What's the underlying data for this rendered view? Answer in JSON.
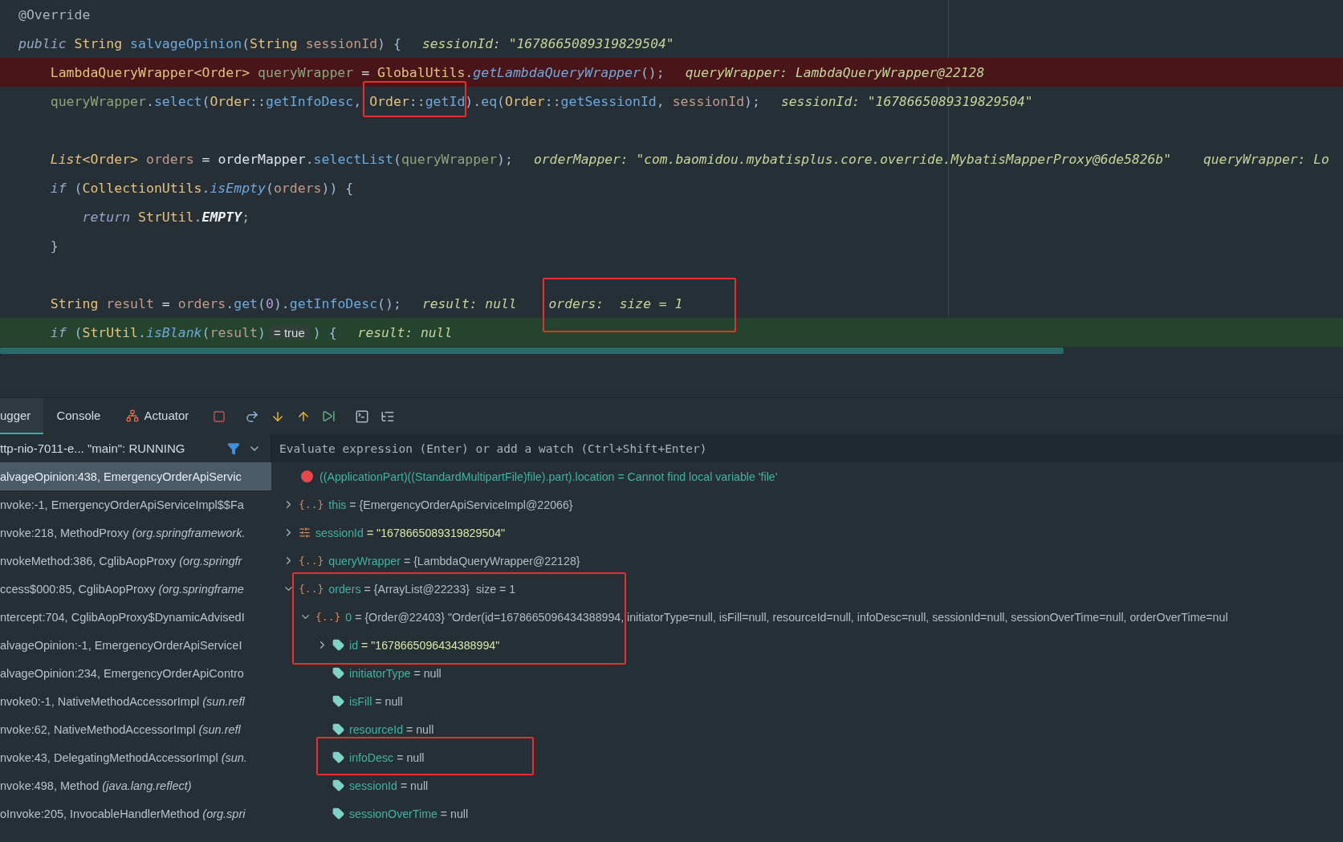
{
  "editor": {
    "lines": [
      {
        "kind": "code",
        "breakpoint": false,
        "execution_point": false,
        "tokens": [
          {
            "text": "@Override",
            "kind": "annotation"
          }
        ]
      },
      {
        "kind": "code",
        "breakpoint": false,
        "execution_point": false,
        "tokens": [
          {
            "text": "public",
            "kind": "kw"
          },
          {
            "text": " String ",
            "kind": "type"
          },
          {
            "text": "salvageOpinion",
            "kind": "method"
          },
          {
            "text": "(",
            "kind": "punct"
          },
          {
            "text": "String ",
            "kind": "type"
          },
          {
            "text": "sessionId",
            "kind": "local"
          },
          {
            "text": ") {",
            "kind": "punct"
          }
        ],
        "hints": [
          "sessionId: \"1678665089319829504\""
        ]
      },
      {
        "kind": "code",
        "breakpoint": true,
        "execution_point": false,
        "tokens": [
          {
            "text": "    LambdaQueryWrapper<Order> ",
            "kind": "type"
          },
          {
            "text": "queryWrapper",
            "kind": "field"
          },
          {
            "text": " = ",
            "kind": "plain"
          },
          {
            "text": "GlobalUtils",
            "kind": "type"
          },
          {
            "text": ".",
            "kind": "punct"
          },
          {
            "text": "getLambdaQueryWrapper",
            "kind": "static"
          },
          {
            "text": "();",
            "kind": "punct"
          }
        ],
        "hints": [
          "queryWrapper: LambdaQueryWrapper@22128"
        ]
      },
      {
        "kind": "code",
        "breakpoint": false,
        "execution_point": false,
        "tokens": [
          {
            "text": "    queryWrapper",
            "kind": "field"
          },
          {
            "text": ".",
            "kind": "punct"
          },
          {
            "text": "select",
            "kind": "method"
          },
          {
            "text": "(",
            "kind": "punct"
          },
          {
            "text": "Order",
            "kind": "type"
          },
          {
            "text": "::",
            "kind": "punct"
          },
          {
            "text": "getInfoDesc",
            "kind": "method"
          },
          {
            "text": ", ",
            "kind": "punct"
          },
          {
            "text": "Order",
            "kind": "type"
          },
          {
            "text": "::",
            "kind": "punct"
          },
          {
            "text": "getId",
            "kind": "method"
          },
          {
            "text": ").",
            "kind": "punct"
          },
          {
            "text": "eq",
            "kind": "method"
          },
          {
            "text": "(",
            "kind": "punct"
          },
          {
            "text": "Order",
            "kind": "type"
          },
          {
            "text": "::",
            "kind": "punct"
          },
          {
            "text": "getSessionId",
            "kind": "method"
          },
          {
            "text": ", ",
            "kind": "punct"
          },
          {
            "text": "sessionId",
            "kind": "local"
          },
          {
            "text": ");",
            "kind": "punct"
          }
        ],
        "hints": [
          "sessionId: \"1678665089319829504\""
        ]
      },
      {
        "kind": "blank"
      },
      {
        "kind": "code",
        "breakpoint": false,
        "execution_point": false,
        "tokens": [
          {
            "text": "    List",
            "kind": "kwtype"
          },
          {
            "text": "<Order> ",
            "kind": "type"
          },
          {
            "text": "orders",
            "kind": "local"
          },
          {
            "text": " = ",
            "kind": "plain"
          },
          {
            "text": "orderMapper",
            "kind": "plain"
          },
          {
            "text": ".",
            "kind": "punct"
          },
          {
            "text": "selectList",
            "kind": "method"
          },
          {
            "text": "(",
            "kind": "punct"
          },
          {
            "text": "queryWrapper",
            "kind": "field"
          },
          {
            "text": ");",
            "kind": "punct"
          }
        ],
        "hints": [
          "orderMapper: \"com.baomidou.mybatisplus.core.override.MybatisMapperProxy@6de5826b\"",
          "queryWrapper: Lo"
        ]
      },
      {
        "kind": "code",
        "breakpoint": false,
        "execution_point": false,
        "tokens": [
          {
            "text": "    if",
            "kind": "kw"
          },
          {
            "text": " (",
            "kind": "punct"
          },
          {
            "text": "CollectionUtils",
            "kind": "type"
          },
          {
            "text": ".",
            "kind": "punct"
          },
          {
            "text": "isEmpty",
            "kind": "static"
          },
          {
            "text": "(",
            "kind": "punct"
          },
          {
            "text": "orders",
            "kind": "local"
          },
          {
            "text": ")) {",
            "kind": "punct"
          }
        ]
      },
      {
        "kind": "code",
        "breakpoint": false,
        "execution_point": false,
        "tokens": [
          {
            "text": "        return",
            "kind": "kw"
          },
          {
            "text": " StrUtil",
            "kind": "type"
          },
          {
            "text": ".",
            "kind": "punct"
          },
          {
            "text": "EMPTY",
            "kind": "const"
          },
          {
            "text": ";",
            "kind": "punct"
          }
        ]
      },
      {
        "kind": "code",
        "breakpoint": false,
        "execution_point": false,
        "tokens": [
          {
            "text": "    }",
            "kind": "punct"
          }
        ]
      },
      {
        "kind": "blank"
      },
      {
        "kind": "code",
        "breakpoint": false,
        "execution_point": false,
        "tokens": [
          {
            "text": "    String ",
            "kind": "type"
          },
          {
            "text": "result",
            "kind": "local"
          },
          {
            "text": " = ",
            "kind": "plain"
          },
          {
            "text": "orders",
            "kind": "local"
          },
          {
            "text": ".",
            "kind": "punct"
          },
          {
            "text": "get",
            "kind": "method"
          },
          {
            "text": "(",
            "kind": "punct"
          },
          {
            "text": "0",
            "kind": "number"
          },
          {
            "text": ").",
            "kind": "punct"
          },
          {
            "text": "getInfoDesc",
            "kind": "method"
          },
          {
            "text": "();",
            "kind": "punct"
          }
        ],
        "hints": [
          "result: null",
          "orders:  size = 1"
        ]
      },
      {
        "kind": "code",
        "breakpoint": false,
        "execution_point": true,
        "tokens": [
          {
            "text": "    if",
            "kind": "kw"
          },
          {
            "text": " (",
            "kind": "punct"
          },
          {
            "text": "StrUtil",
            "kind": "type"
          },
          {
            "text": ".",
            "kind": "punct"
          },
          {
            "text": "isBlank",
            "kind": "static"
          },
          {
            "text": "(",
            "kind": "punct"
          },
          {
            "text": "result",
            "kind": "local"
          },
          {
            "text": ")",
            "kind": "punct"
          },
          {
            "text": "= true",
            "kind": "chip"
          },
          {
            "text": ") {",
            "kind": "punct"
          }
        ],
        "hints": [
          "result: null"
        ]
      }
    ]
  },
  "debugger": {
    "tabs": [
      {
        "label": "ugger",
        "selected": true,
        "icon": false
      },
      {
        "label": "Console",
        "selected": false,
        "icon": false
      },
      {
        "label": "Actuator",
        "selected": false,
        "icon": true
      }
    ],
    "thread": "ttp-nio-7011-e... \"main\": RUNNING",
    "evaluate": {
      "placeholder": "Evaluate expression (Enter) or add a watch (Ctrl+Shift+Enter)"
    },
    "frames": [
      {
        "method": "alvageOpinion:438, EmergencyOrderApiServic",
        "selected": true
      },
      {
        "method": "nvoke:-1, EmergencyOrderApiServiceImpl$$Fa",
        "selected": false
      },
      {
        "method": "nvoke:218, MethodProxy",
        "location": "(org.springframework.",
        "selected": false
      },
      {
        "method": "nvokeMethod:386, CglibAopProxy",
        "location": "(org.springfr",
        "selected": false
      },
      {
        "method": "ccess$000:85, CglibAopProxy",
        "location": "(org.springframe",
        "selected": false
      },
      {
        "method": "ntercept:704, CglibAopProxy$DynamicAdvisedI",
        "selected": false
      },
      {
        "method": "alvageOpinion:-1, EmergencyOrderApiServiceI",
        "selected": false
      },
      {
        "method": "alvageOpinion:234, EmergencyOrderApiContro",
        "selected": false
      },
      {
        "method": "nvoke0:-1, NativeMethodAccessorImpl",
        "location": "(sun.refl",
        "selected": false
      },
      {
        "method": "nvoke:62, NativeMethodAccessorImpl",
        "location": "(sun.refl",
        "selected": false
      },
      {
        "method": "nvoke:43, DelegatingMethodAccessorImpl",
        "location": "(sun.",
        "selected": false
      },
      {
        "method": "nvoke:498, Method",
        "location": "(java.lang.reflect)",
        "selected": false
      },
      {
        "method": "oInvoke:205, InvocableHandlerMethod",
        "location": "(org.spri",
        "selected": false
      }
    ],
    "variables": [
      {
        "kind": "error",
        "text": "((ApplicationPart)((StandardMultipartFile)file).part).location = Cannot find local variable 'file'"
      },
      {
        "kind": "object",
        "expanded": false,
        "icon": "{..}",
        "name": "this",
        "value": "= {EmergencyOrderApiServiceImpl@22066}",
        "string_value": false
      },
      {
        "kind": "primitive",
        "expanded": false,
        "name": "sessionId",
        "value": "= \"1678665089319829504\"",
        "string_value": true
      },
      {
        "kind": "object",
        "expanded": false,
        "icon": "{..}",
        "name": "queryWrapper",
        "value": "= {LambdaQueryWrapper@22128}",
        "string_value": false
      },
      {
        "kind": "object",
        "expanded": true,
        "icon": "{..}",
        "name": "orders",
        "value": "= {ArrayList@22233}",
        "string_value": false,
        "extra": "size = 1",
        "children": [
          {
            "kind": "object",
            "expanded": true,
            "icon": "{..}",
            "name": "0",
            "value": "= {Order@22403} \"Order(id=1678665096434388994, initiatorType=null, isFill=null, resourceId=null, infoDesc=null, sessionId=null, sessionOverTime=null, orderOverTime=nul",
            "string_value": false,
            "children": [
              {
                "kind": "field",
                "expanded": false,
                "name": "id",
                "value": "= \"1678665096434388994\"",
                "string_value": true
              },
              {
                "kind": "field",
                "name": "initiatorType",
                "value": "= null",
                "string_value": false
              },
              {
                "kind": "field",
                "name": "isFill",
                "value": "= null",
                "string_value": false
              },
              {
                "kind": "field",
                "name": "resourceId",
                "value": "= null",
                "string_value": false
              },
              {
                "kind": "field",
                "name": "infoDesc",
                "value": "= null",
                "string_value": false
              },
              {
                "kind": "field",
                "name": "sessionId",
                "value": "= null",
                "string_value": false
              },
              {
                "kind": "field",
                "name": "sessionOverTime",
                "value": "= null",
                "string_value": false
              }
            ]
          }
        ]
      }
    ]
  }
}
